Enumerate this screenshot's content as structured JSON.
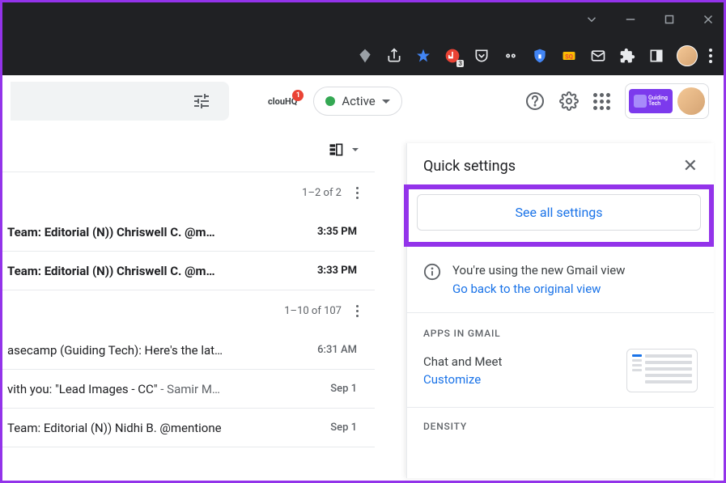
{
  "titlebar": {
    "controls": [
      "chevron",
      "minimize",
      "maximize",
      "close"
    ]
  },
  "toolbar": {
    "extensions": [
      "diamond",
      "share",
      "star-blue",
      "adblock",
      "pocket",
      "eyes",
      "shield",
      "sq",
      "mail",
      "puzzle",
      "panel"
    ],
    "adblock_badge": "3"
  },
  "gmail_header": {
    "cloudhq": "clouHQ",
    "cloudhq_badge": "1",
    "status": "Active",
    "gt_label": "Guiding\nTech"
  },
  "list1": {
    "count": "1–2 of 2",
    "rows": [
      {
        "subject": "Team: Editorial (N)) Chriswell C. @m…",
        "time": "3:35 PM",
        "unread": true
      },
      {
        "subject": "Team: Editorial (N)) Chriswell C. @m…",
        "time": "3:33 PM",
        "unread": true
      }
    ]
  },
  "list2": {
    "count": "1–10 of 107",
    "rows": [
      {
        "subject": "asecamp (Guiding Tech): Here's the lat…",
        "time": "6:31 AM",
        "unread": false
      },
      {
        "subject": "vith you: \"Lead Images - CC\" ",
        "sender": "- Samir M…",
        "time": "Sep 1",
        "unread": false
      },
      {
        "subject": "Team: Editorial (N)) Nidhi B. @mentione",
        "time": "Sep 1",
        "unread": false
      }
    ]
  },
  "quick_settings": {
    "title": "Quick settings",
    "see_all": "See all settings",
    "info_line": "You're using the new Gmail view",
    "go_back": "Go back to the original view",
    "apps_label": "APPS IN GMAIL",
    "chat_meet": "Chat and Meet",
    "customize": "Customize",
    "density_label": "DENSITY"
  }
}
